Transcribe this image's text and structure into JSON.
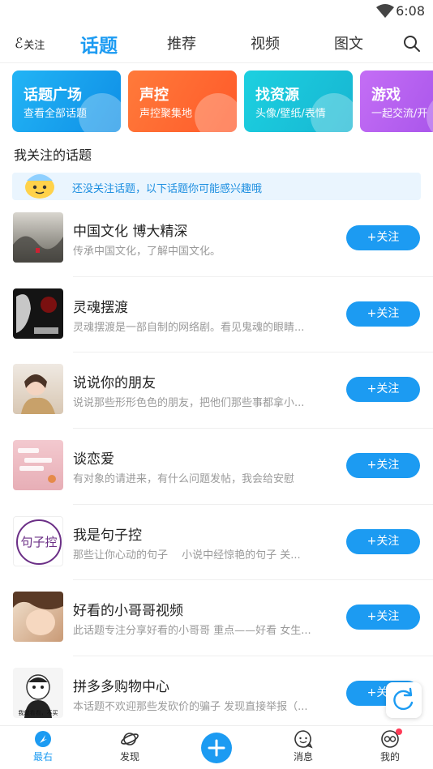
{
  "status_bar": {
    "time": "6:08"
  },
  "top_nav": {
    "follow_label": "关注",
    "tabs": [
      {
        "label": "话题",
        "active": true
      },
      {
        "label": "推荐",
        "active": false
      },
      {
        "label": "视频",
        "active": false
      },
      {
        "label": "图文",
        "active": false
      }
    ]
  },
  "categories": [
    {
      "title": "话题广场",
      "subtitle": "查看全部话题",
      "color": "#17a3ee"
    },
    {
      "title": "声控",
      "subtitle": "声控聚集地",
      "color": "#ff6a2d"
    },
    {
      "title": "找资源",
      "subtitle": "头像/壁纸/表情",
      "color": "#19c3d8"
    },
    {
      "title": "游戏",
      "subtitle": "一起交流/开",
      "color": "#b05cf0"
    }
  ],
  "section": {
    "title": "我关注的话题",
    "notice": "还没关注话题，以下话题你可能感兴趣哦"
  },
  "topics": [
    {
      "name": "中国文化 博大精深",
      "desc": "传承中国文化，了解中国文化。",
      "follow_label": "+关注"
    },
    {
      "name": "灵魂摆渡",
      "desc": "灵魂摆渡是一部自制的网络剧。看见鬼魂的眼睛...",
      "follow_label": "+关注"
    },
    {
      "name": "说说你的朋友",
      "desc": "说说那些形形色色的朋友，把他们那些事都拿小...",
      "follow_label": "+关注"
    },
    {
      "name": "谈恋爱",
      "desc": "有对象的请进来，有什么问题发帖，我会给安慰",
      "follow_label": "+关注"
    },
    {
      "name": "我是句子控",
      "desc": "那些让你心动的句子　 小说中经惊艳的句子 关...",
      "follow_label": "+关注"
    },
    {
      "name": "好看的小哥哥视频",
      "desc": "此话题专注分享好看的小哥哥 重点——好看 女生...",
      "follow_label": "+关注"
    },
    {
      "name": "拼多多购物中心",
      "desc": "本话题不欢迎那些发砍价的骗子 发现直接举报（...",
      "follow_label": "+关注"
    }
  ],
  "thumb_texts": {
    "sentence": "句子控",
    "meme": "我就看看，不买"
  },
  "bottom_nav": {
    "items": [
      {
        "label": "最右",
        "active": true
      },
      {
        "label": "发现",
        "active": false
      },
      {
        "label": "消息",
        "active": false
      },
      {
        "label": "我的",
        "active": false
      }
    ]
  },
  "icons": {
    "search": "search-icon",
    "wifi": "wifi-icon",
    "refresh": "refresh-icon",
    "plus": "plus-icon"
  },
  "colors": {
    "accent": "#1c9bf2",
    "badge": "#ff3b57"
  }
}
